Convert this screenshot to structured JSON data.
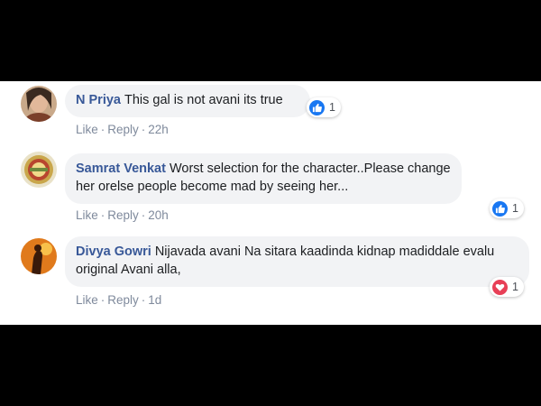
{
  "comments": [
    {
      "author": "N Priya",
      "text": "This gal is not avani its true",
      "actions": {
        "like": "Like",
        "reply": "Reply",
        "time": "22h"
      },
      "reaction": {
        "type": "like",
        "count": "1",
        "color": "#1877f2"
      }
    },
    {
      "author": "Samrat Venkat",
      "text": "Worst selection for the character..Please change her orelse people become mad by seeing her...",
      "actions": {
        "like": "Like",
        "reply": "Reply",
        "time": "20h"
      },
      "reaction": {
        "type": "like",
        "count": "1",
        "color": "#1877f2"
      }
    },
    {
      "author": "Divya Gowri",
      "text": "Nijavada avani Na sitara kaadinda kidnap madiddale evalu original Avani alla,",
      "actions": {
        "like": "Like",
        "reply": "Reply",
        "time": "1d"
      },
      "reaction": {
        "type": "love",
        "count": "1",
        "color": "#e84057"
      }
    }
  ],
  "separator": "·"
}
